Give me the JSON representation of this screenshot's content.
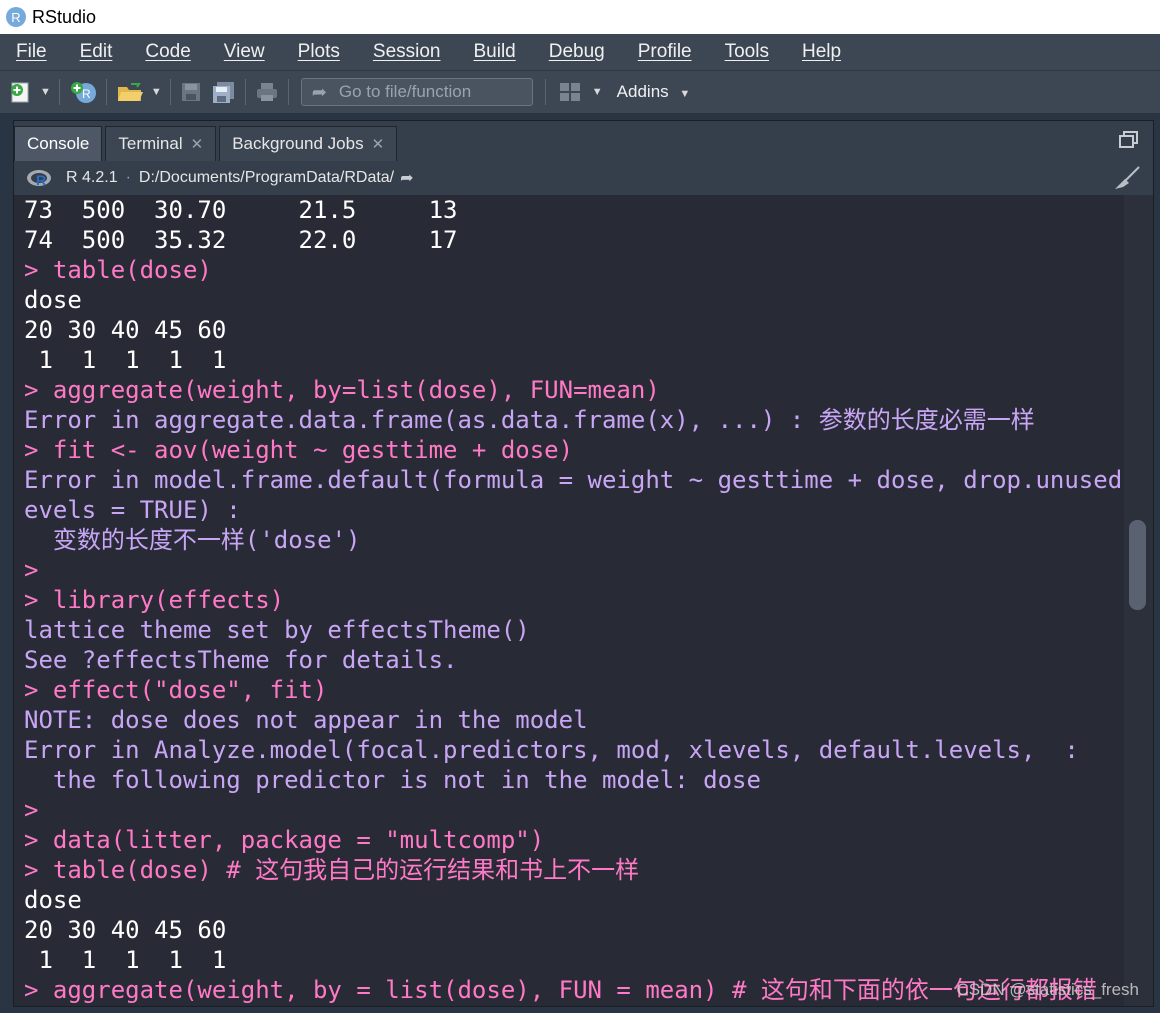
{
  "window": {
    "title": "RStudio"
  },
  "menu": {
    "items": [
      "File",
      "Edit",
      "Code",
      "View",
      "Plots",
      "Session",
      "Build",
      "Debug",
      "Profile",
      "Tools",
      "Help"
    ]
  },
  "toolbar": {
    "goto_placeholder": "Go to file/function",
    "addins_label": "Addins"
  },
  "tabs": [
    {
      "label": "Console",
      "active": true
    },
    {
      "label": "Terminal",
      "closable": true
    },
    {
      "label": "Background Jobs",
      "closable": true
    }
  ],
  "path_bar": {
    "r_version": "R 4.2.1",
    "separator": "·",
    "working_dir": "D:/Documents/ProgramData/RData/"
  },
  "colors": {
    "output": "#ffffff",
    "command": "#ff79c6",
    "error": "#c9a6f5"
  },
  "console_lines": [
    {
      "text": "73  500  30.70     21.5     13",
      "type": "out"
    },
    {
      "text": "74  500  35.32     22.0     17",
      "type": "out"
    },
    {
      "text": "> table(dose)",
      "type": "cmd"
    },
    {
      "text": "dose",
      "type": "out"
    },
    {
      "text": "20 30 40 45 60",
      "type": "out"
    },
    {
      "text": " 1  1  1  1  1",
      "type": "out"
    },
    {
      "text": "> aggregate(weight, by=list(dose), FUN=mean)",
      "type": "cmd"
    },
    {
      "text": "Error in aggregate.data.frame(as.data.frame(x), ...) : 参数的长度必需一样",
      "type": "err"
    },
    {
      "text": "> fit <- aov(weight ~ gesttime + dose)",
      "type": "cmd"
    },
    {
      "text": "Error in model.frame.default(formula = weight ~ gesttime + dose, drop.unused.l",
      "type": "err"
    },
    {
      "text": "evels = TRUE) :",
      "type": "err"
    },
    {
      "text": "  变数的长度不一样('dose')",
      "type": "err"
    },
    {
      "text": ">",
      "type": "cmd"
    },
    {
      "text": "> library(effects)",
      "type": "cmd"
    },
    {
      "text": "lattice theme set by effectsTheme()",
      "type": "err"
    },
    {
      "text": "See ?effectsTheme for details.",
      "type": "err"
    },
    {
      "text": "> effect(\"dose\", fit)",
      "type": "cmd"
    },
    {
      "text": "NOTE: dose does not appear in the model",
      "type": "err"
    },
    {
      "text": "Error in Analyze.model(focal.predictors, mod, xlevels, default.levels,  :",
      "type": "err"
    },
    {
      "text": "  the following predictor is not in the model: dose",
      "type": "err"
    },
    {
      "text": ">",
      "type": "cmd"
    },
    {
      "text": "> data(litter, package = \"multcomp\")",
      "type": "cmd"
    },
    {
      "text": "> table(dose) # 这句我自己的运行结果和书上不一样",
      "type": "cmd"
    },
    {
      "text": "dose",
      "type": "out"
    },
    {
      "text": "20 30 40 45 60",
      "type": "out"
    },
    {
      "text": " 1  1  1  1  1",
      "type": "out"
    },
    {
      "text": "> aggregate(weight, by = list(dose), FUN = mean) # 这句和下面的依一句运行都报错",
      "type": "cmd"
    }
  ],
  "watermark": "CSDN @statistics_fresh"
}
